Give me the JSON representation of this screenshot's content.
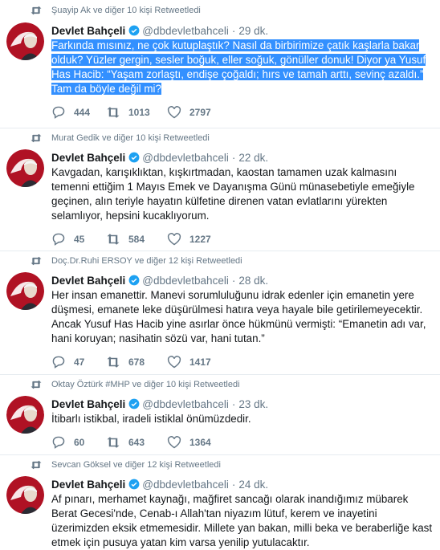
{
  "colors": {
    "accent": "#1da1f2",
    "muted": "#657786",
    "selection": "#3390ff",
    "avatar_bg": "#b01224"
  },
  "tweets": [
    {
      "retweet_context": "Şuayip Ak ve diğer 10 kişi Retweetledi",
      "author_name": "Devlet Bahçeli",
      "handle": "@dbdevletbahceli",
      "separator": "·",
      "time": "29 dk.",
      "text": "Farkında mısınız, ne çok kutuplaştık? Nasıl da birbirimize çatık kaşlarla bakar olduk? Yüzler gergin, sesler boğuk, eller soğuk, gönüller donuk! Diyor ya Yusuf Has Hacib: “Yaşam zorlaştı, endişe çoğaldı; hırs ve tamah arttı, sevinç azaldı.” Tam da böyle değil mi?",
      "replies": "444",
      "retweets": "1013",
      "likes": "2797",
      "text_selected": true
    },
    {
      "retweet_context": "Murat Gedik ve diğer 10 kişi Retweetledi",
      "author_name": "Devlet Bahçeli",
      "handle": "@dbdevletbahceli",
      "separator": "·",
      "time": "22 dk.",
      "text": "Kavgadan, karışıklıktan, kışkırtmadan, kaostan tamamen uzak kalmasını temenni ettiğim 1 Mayıs Emek ve Dayanışma Günü münasebetiyle emeğiyle geçinen, alın teriyle hayatın külfetine direnen vatan evlatlarını yürekten selamlıyor, hepsini kucaklıyorum.",
      "replies": "45",
      "retweets": "584",
      "likes": "1227"
    },
    {
      "retweet_context": "Doç.Dr.Ruhi ERSOY ve diğer 12 kişi Retweetledi",
      "author_name": "Devlet Bahçeli",
      "handle": "@dbdevletbahceli",
      "separator": "·",
      "time": "28 dk.",
      "text": "Her insan emanettir. Manevi sorumluluğunu idrak edenler için emanetin yere düşmesi, emanete leke düşürülmesi hatıra veya hayale bile getirilemeyecektir. Ancak Yusuf Has Hacib yine asırlar önce hükmünü vermişti: “Emanetin adı var, hani koruyan; nasihatin sözü var, hani tutan.”",
      "replies": "47",
      "retweets": "678",
      "likes": "1417"
    },
    {
      "retweet_context": "Oktay Öztürk #MHP ve diğer 10 kişi Retweetledi",
      "author_name": "Devlet Bahçeli",
      "handle": "@dbdevletbahceli",
      "separator": "·",
      "time": "23 dk.",
      "text": "İtibarlı istikbal, iradeli istiklal önümüzdedir.",
      "replies": "60",
      "retweets": "643",
      "likes": "1364"
    },
    {
      "retweet_context": "Sevcan Göksel ve diğer 12 kişi Retweetledi",
      "author_name": "Devlet Bahçeli",
      "handle": "@dbdevletbahceli",
      "separator": "·",
      "time": "24 dk.",
      "text": "Af pınarı, merhamet kaynağı, mağfiret sancağı olarak inandığımız mübarek Berat Gecesi'nde, Cenab-ı Allah'tan niyazım lütuf, kerem ve inayetini üzerimizden eksik etmemesidir. Millete yan bakan, milli beka ve beraberliğe kast etmek için pusuya yatan kim varsa yenilip yutulacaktır."
    }
  ],
  "icons": {
    "retweet_context": "retweet-icon",
    "verified": "verified-badge-icon",
    "reply": "reply-icon",
    "retweet": "retweet-icon",
    "like": "heart-icon"
  }
}
